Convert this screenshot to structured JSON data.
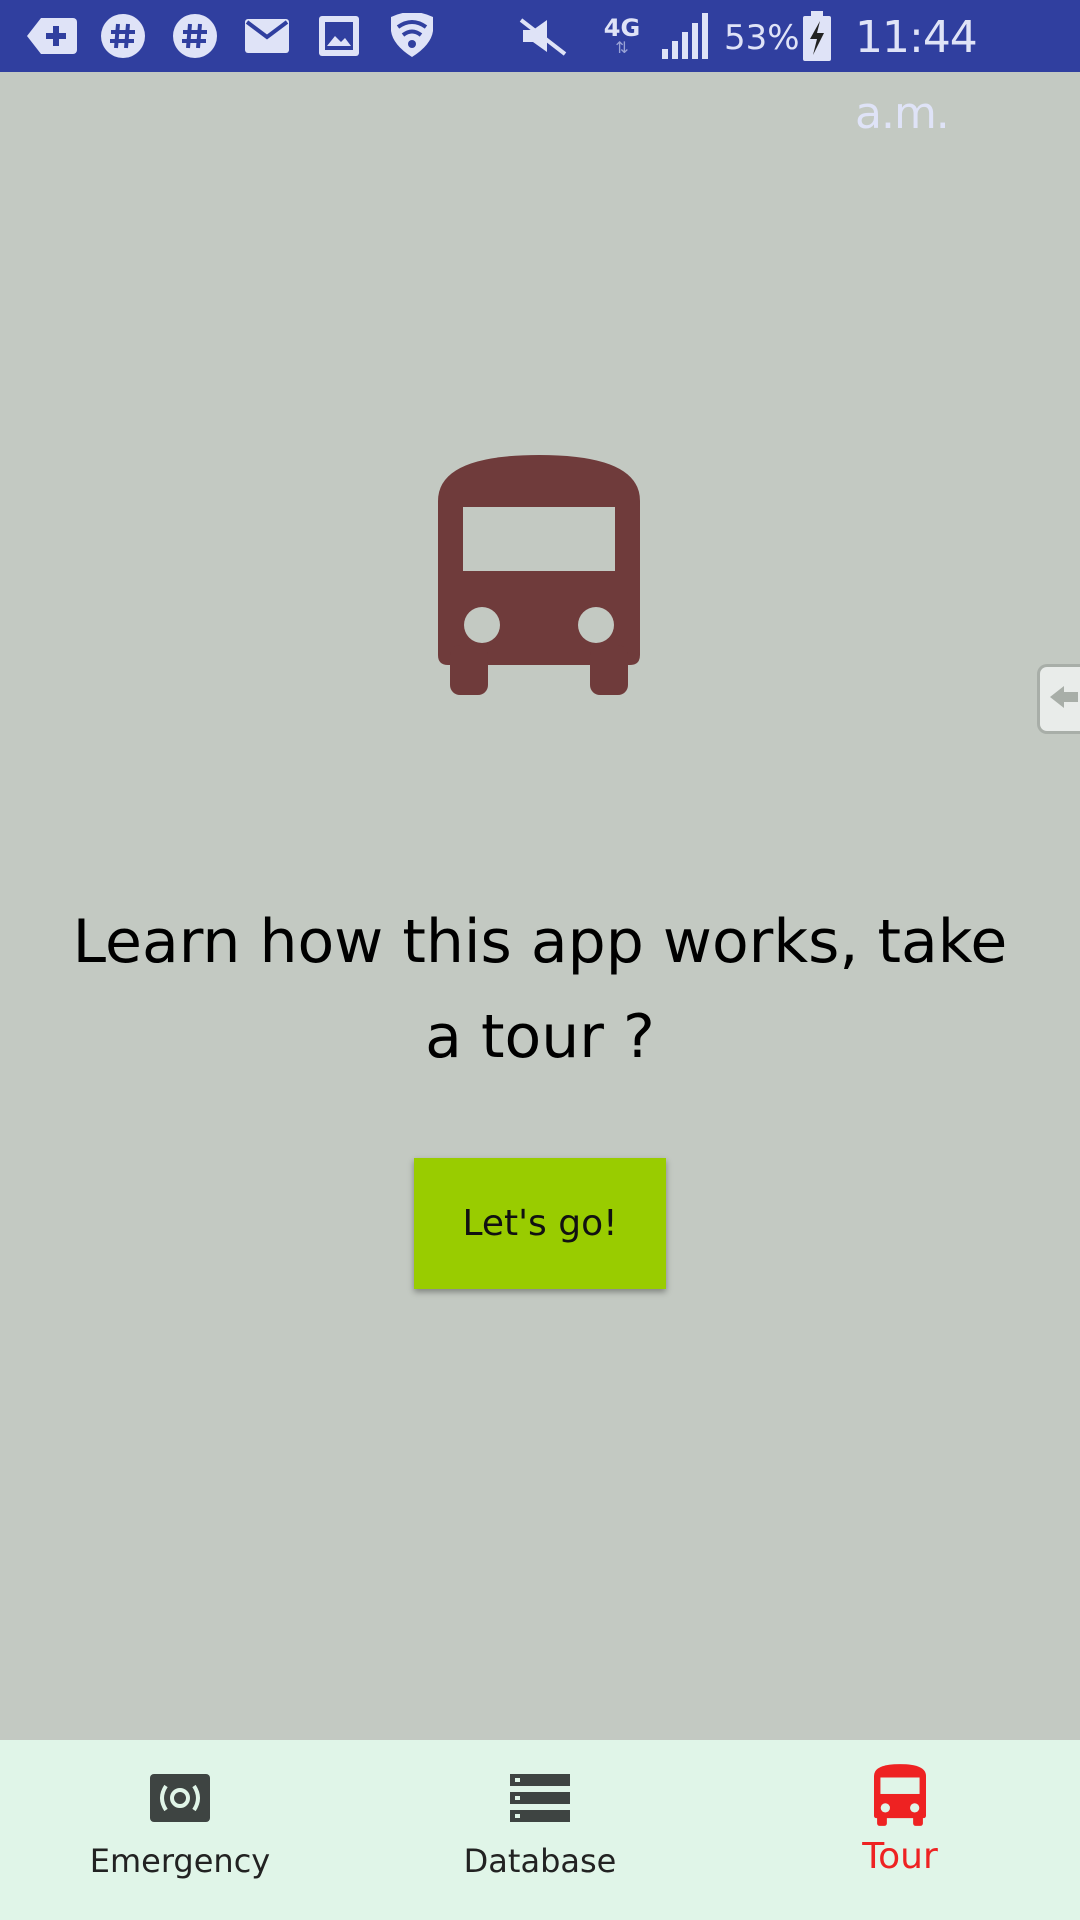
{
  "status_bar": {
    "battery_percent": "53%",
    "time": "11:44 a.m.",
    "network_type": "4G",
    "icons": [
      "add-icon",
      "hashtag-icon",
      "hashtag-icon",
      "mail-icon",
      "image-icon",
      "wifi-icon",
      "mute-icon",
      "network-4g-icon",
      "signal-icon",
      "battery-charging-icon"
    ],
    "background_color": "#303f9f"
  },
  "main": {
    "hero_icon": "bus-icon",
    "hero_icon_color": "#6f3b3b",
    "prompt_text": "Learn how this app works, take a tour ?",
    "button_label": "Let's go!",
    "button_color": "#99cc00",
    "background_color": "#c3c9c2"
  },
  "bottom_nav": {
    "items": [
      {
        "label": "Emergency",
        "icon": "emergency-icon",
        "active": false
      },
      {
        "label": "Database",
        "icon": "database-icon",
        "active": false
      },
      {
        "label": "Tour",
        "icon": "bus-icon",
        "active": true
      }
    ],
    "active_color": "#ee2222",
    "background_color": "#e0f5e8"
  }
}
